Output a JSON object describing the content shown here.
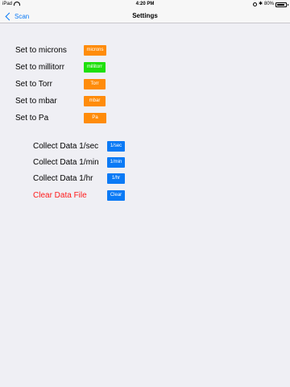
{
  "status_bar": {
    "device": "iPad",
    "time": "4:20 PM",
    "battery": "80%"
  },
  "nav": {
    "back_label": "Scan",
    "title": "Settings"
  },
  "units": [
    {
      "label": "Set to microns",
      "button": "microns",
      "color": "#ff8c0a"
    },
    {
      "label": "Set to millitorr",
      "button": "millitorr",
      "color": "#1ee00a"
    },
    {
      "label": "Set to Torr",
      "button": "Torr",
      "color": "#ff8c0a"
    },
    {
      "label": "Set to mbar",
      "button": "mbar",
      "color": "#ff8c0a"
    },
    {
      "label": "Set to Pa",
      "button": "Pa",
      "color": "#ff8c0a"
    }
  ],
  "collect": [
    {
      "label": "Collect Data 1/sec",
      "button": "1/sec"
    },
    {
      "label": "Collect Data 1/min",
      "button": "1/min"
    },
    {
      "label": "Collect Data 1/hr",
      "button": "1/hr"
    }
  ],
  "clear": {
    "label": "Clear Data File",
    "button": "Clear",
    "label_color": "#ff1a1a",
    "button_color": "#0b7af5"
  }
}
